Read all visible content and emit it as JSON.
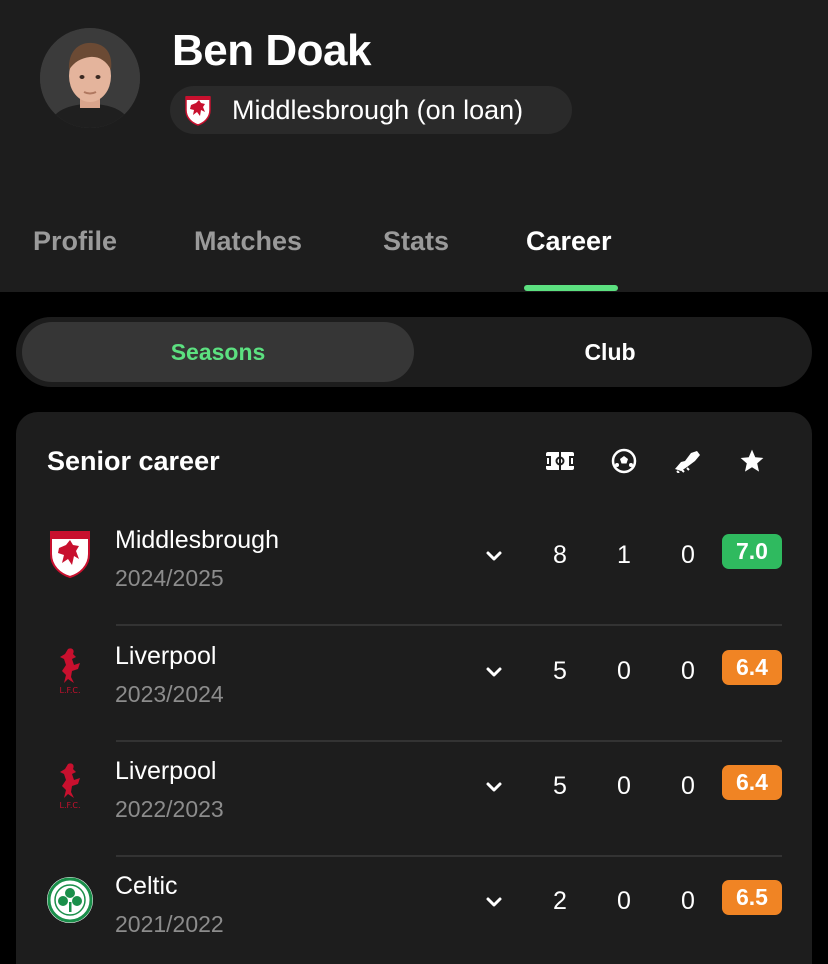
{
  "player": {
    "name": "Ben Doak",
    "club_label": "Middlesbrough (on loan)"
  },
  "tabs": [
    "Profile",
    "Matches",
    "Stats",
    "Career"
  ],
  "active_tab": "Career",
  "toggle": {
    "left": "Seasons",
    "right": "Club",
    "selected": "Seasons"
  },
  "career": {
    "title": "Senior career",
    "columns": [
      "appearances-icon",
      "goals-icon",
      "assists-icon",
      "rating-icon"
    ],
    "rows": [
      {
        "club": "Middlesbrough",
        "season": "2024/2025",
        "apps": "8",
        "goals": "1",
        "assists": "0",
        "rating": "7.0",
        "rating_color": "#2fba5f",
        "logo": "middlesbrough-crest-icon"
      },
      {
        "club": "Liverpool",
        "season": "2023/2024",
        "apps": "5",
        "goals": "0",
        "assists": "0",
        "rating": "6.4",
        "rating_color": "#f08424",
        "logo": "liverpool-crest-icon"
      },
      {
        "club": "Liverpool",
        "season": "2022/2023",
        "apps": "5",
        "goals": "0",
        "assists": "0",
        "rating": "6.4",
        "rating_color": "#f08424",
        "logo": "liverpool-crest-icon"
      },
      {
        "club": "Celtic",
        "season": "2021/2022",
        "apps": "2",
        "goals": "0",
        "assists": "0",
        "rating": "6.5",
        "rating_color": "#f08424",
        "logo": "celtic-crest-icon"
      }
    ]
  },
  "colors": {
    "accent": "#5ce080",
    "background": "#000000",
    "surface": "#1d1d1d"
  }
}
